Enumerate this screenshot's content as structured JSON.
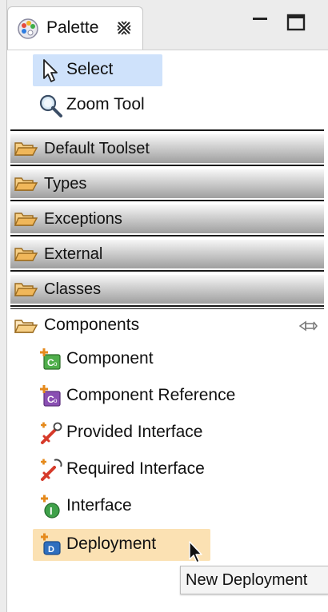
{
  "view": {
    "tab_title": "Palette",
    "close_icon": "close-icon",
    "minimize_icon": "minimize-icon",
    "maximize_icon": "maximize-icon"
  },
  "tools": [
    {
      "label": "Select",
      "icon": "arrow-pointer-icon",
      "selected": true
    },
    {
      "label": "Zoom Tool",
      "icon": "magnifier-icon",
      "selected": false
    }
  ],
  "drawers": [
    {
      "label": "Default Toolset",
      "icon": "folder-icon",
      "expanded": false
    },
    {
      "label": "Types",
      "icon": "folder-icon",
      "expanded": false
    },
    {
      "label": "Exceptions",
      "icon": "folder-icon",
      "expanded": false
    },
    {
      "label": "External",
      "icon": "folder-icon",
      "expanded": false
    },
    {
      "label": "Classes",
      "icon": "folder-icon",
      "expanded": false
    }
  ],
  "components_drawer": {
    "label": "Components",
    "icon": "folder-open-icon",
    "pin_icon": "pin-icon",
    "items": [
      {
        "label": "Component",
        "icon": "component-icon"
      },
      {
        "label": "Component Reference",
        "icon": "component-reference-icon"
      },
      {
        "label": "Provided Interface",
        "icon": "provided-interface-icon"
      },
      {
        "label": "Required Interface",
        "icon": "required-interface-icon"
      },
      {
        "label": "Interface",
        "icon": "interface-icon"
      },
      {
        "label": "Deployment",
        "icon": "deployment-icon",
        "hovered": true
      }
    ]
  },
  "tooltip": {
    "text": "New Deployment"
  },
  "colors": {
    "selection": "#cfe2fb",
    "hover": "#fbe1b3",
    "drawer_dark": "#9f9f9f",
    "folder": "#f0b75a"
  }
}
